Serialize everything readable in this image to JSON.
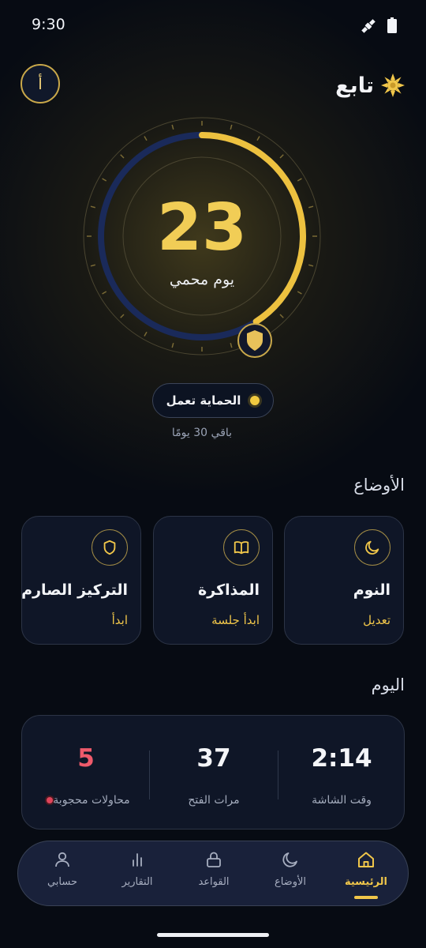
{
  "status_bar": {
    "time": "9:30"
  },
  "header": {
    "app_name": "تابع",
    "avatar_letter": "أ"
  },
  "hero": {
    "days_count": "23",
    "days_label": "يوم محمي",
    "status_text": "الحماية تعمل",
    "remaining_text": "باقي 30 يومًا",
    "progress_fraction": 0.41
  },
  "modes": {
    "title": "الأوضاع",
    "items": [
      {
        "title": "النوم",
        "action": "تعديل",
        "icon": "moon-icon"
      },
      {
        "title": "المذاكرة",
        "action": "ابدأ جلسة",
        "icon": "book-icon"
      },
      {
        "title": "التركيز الصارم",
        "action": "ابدأ",
        "icon": "shield-icon"
      }
    ]
  },
  "today": {
    "title": "اليوم",
    "stats": [
      {
        "value": "2:14",
        "label": "وقت الشاشة"
      },
      {
        "value": "37",
        "label": "مرات الفتح"
      },
      {
        "value": "5",
        "label": "محاولات محجوبة"
      }
    ]
  },
  "nav": {
    "items": [
      {
        "label": "الرئيسية",
        "icon": "home-icon",
        "active": true
      },
      {
        "label": "الأوضاع",
        "icon": "moon-icon"
      },
      {
        "label": "القواعد",
        "icon": "lock-icon"
      },
      {
        "label": "التقارير",
        "icon": "bar-chart-icon"
      },
      {
        "label": "حسابي",
        "icon": "user-icon"
      }
    ]
  },
  "colors": {
    "accent": "#f0c64a",
    "background": "#070b13",
    "track": "#1a2a5a",
    "blocked": "#e0445b"
  }
}
